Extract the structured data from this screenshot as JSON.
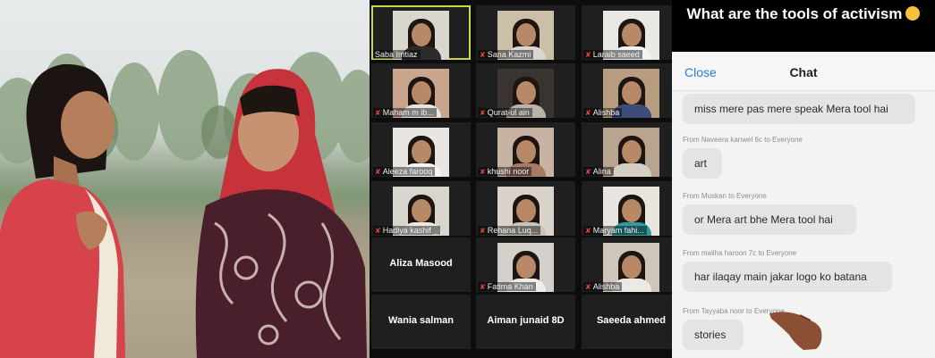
{
  "zoom": {
    "tiles": [
      {
        "name": "Saba Imtiaz",
        "active": true,
        "video": true,
        "bg": "#d9d5cf",
        "shirt": "#2b2b2b",
        "mic_muted": false
      },
      {
        "name": "Sana Kazmi",
        "video": true,
        "bg": "#cbbfa8",
        "shirt": "#d9d6cf",
        "mic_muted": true
      },
      {
        "name": "Laraib saeed",
        "video": true,
        "bg": "#eae8e3",
        "shirt": "#f2f2f2",
        "mic_muted": true
      },
      {
        "name": "Maham m ib...",
        "video": true,
        "bg": "#caa58d",
        "shirt": "#e8e6e2",
        "mic_muted": true
      },
      {
        "name": "Qurat-ul ain",
        "video": true,
        "bg": "#3a3430",
        "shirt": "#b9b4aa",
        "mic_muted": true
      },
      {
        "name": "Alishba",
        "video": true,
        "bg": "#b79c80",
        "shirt": "#3c4d7a",
        "mic_muted": true
      },
      {
        "name": "Aleeza farooq",
        "video": true,
        "bg": "#e9e6e2",
        "shirt": "#f4f4f4",
        "mic_muted": true
      },
      {
        "name": "khushi noor",
        "video": true,
        "bg": "#c8b3a3",
        "shirt": "#a57b66",
        "mic_muted": true
      },
      {
        "name": "Alina",
        "video": true,
        "bg": "#b8a48f",
        "shirt": "#d5cfc3",
        "mic_muted": true
      },
      {
        "name": "Hadiya kashif _",
        "video": true,
        "bg": "#d8d5ce",
        "shirt": "#ebe8e2",
        "mic_muted": true
      },
      {
        "name": "Rehana Luq...",
        "video": true,
        "bg": "#d9d3cb",
        "shirt": "#c9c4bb",
        "mic_muted": true
      },
      {
        "name": "Maryam fahi...",
        "video": true,
        "bg": "#e8e5df",
        "shirt": "#2f9aa0",
        "mic_muted": true
      },
      {
        "name": "Aliza Masood",
        "video": false,
        "mic_muted": false
      },
      {
        "name": "Fatima Khan",
        "video": true,
        "bg": "#d3d0ca",
        "shirt": "#ededeb",
        "mic_muted": true
      },
      {
        "name": "Alishba",
        "video": true,
        "bg": "#cfc6bb",
        "shirt": "#ebe9e4",
        "mic_muted": true
      },
      {
        "name": "Wania salman",
        "video": false,
        "mic_muted": false
      },
      {
        "name": "Aiman junaid 8D",
        "video": false,
        "mic_muted": false
      },
      {
        "name": "Saeeda ahmed",
        "video": false,
        "mic_muted": false
      }
    ]
  },
  "chat": {
    "banner": "What are the tools of activism",
    "close_label": "Close",
    "title": "Chat",
    "messages": [
      {
        "meta": "",
        "text": "miss mere pas mere speak Mera tool hai"
      },
      {
        "meta": "From Naveera kanwel 6c to Everyone",
        "text": "art"
      },
      {
        "meta": "From Muskan to Everyone",
        "text": "or Mera art bhe Mera tool hai"
      },
      {
        "meta": "From maliha haroon 7c to Everyone",
        "text": "har ilaqay main jakar logo ko batana"
      },
      {
        "meta": "From Tayyaba noor to Everyone",
        "text": "stories"
      }
    ]
  },
  "colors": {
    "close": "#2a7bd4",
    "muted_mic": "#e8433d",
    "active_border": "#c9d64a"
  }
}
